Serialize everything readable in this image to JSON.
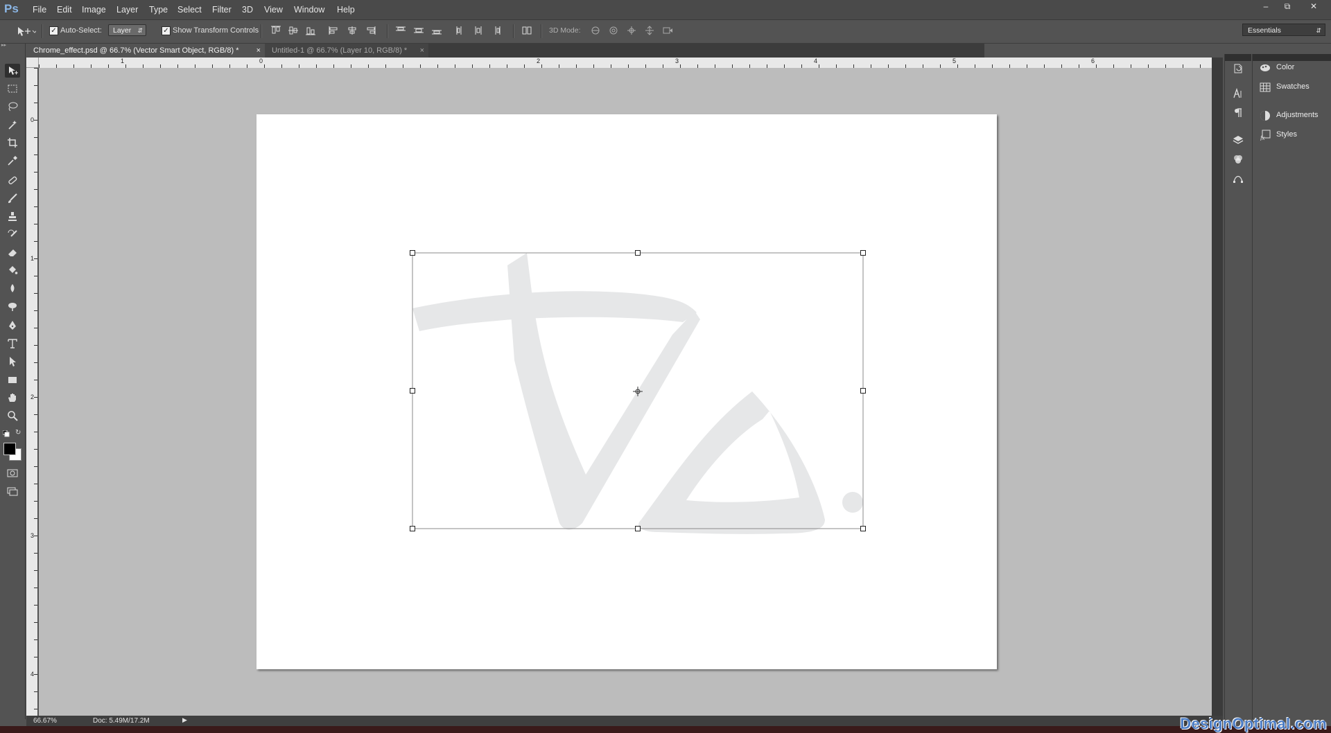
{
  "app": {
    "logo": "Ps"
  },
  "menu": [
    "File",
    "Edit",
    "Image",
    "Layer",
    "Type",
    "Select",
    "Filter",
    "3D",
    "View",
    "Window",
    "Help"
  ],
  "options_bar": {
    "auto_select_label": "Auto-Select:",
    "auto_select_checked": true,
    "auto_select_target": "Layer",
    "show_transform_label": "Show Transform Controls",
    "show_transform_checked": true,
    "mode_3d_label": "3D Mode:",
    "workspace": "Essentials"
  },
  "tabs": [
    {
      "label": "Chrome_effect.psd @ 66.7% (Vector Smart Object, RGB/8) *",
      "active": true,
      "close": "×"
    },
    {
      "label": "Untitled-1 @ 66.7% (Layer 10, RGB/8) *",
      "active": false,
      "close": "×"
    }
  ],
  "ruler_h_labels": [
    "1",
    "0",
    "2",
    "3",
    "4",
    "5",
    "6"
  ],
  "ruler_v_labels": [
    "0",
    "1",
    "2",
    "3",
    "4"
  ],
  "status": {
    "zoom": "66.67%",
    "doc_info": "Doc: 5.49M/17.2M"
  },
  "panels": [
    {
      "label": "Color",
      "icon": "color-icon"
    },
    {
      "label": "Swatches",
      "icon": "swatches-icon"
    },
    {
      "label": "Adjustments",
      "icon": "adjustments-icon"
    },
    {
      "label": "Styles",
      "icon": "styles-icon"
    }
  ],
  "watermark": "DesignOptimal.com",
  "colors": {
    "ui_bg": "#535353",
    "canvas_bg": "#bcbcbc",
    "logo_fill": "#e6e7e8",
    "ps_logo": "#8bb6e6"
  }
}
